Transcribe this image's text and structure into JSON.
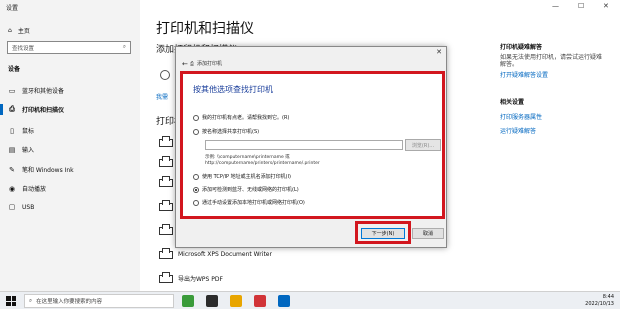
{
  "window": {
    "title": "设置",
    "controls": [
      "—",
      "☐",
      "✕"
    ]
  },
  "sidebar": {
    "home": "主页",
    "search_placeholder": "查找设置",
    "section": "设备",
    "items": [
      {
        "label": "蓝牙和其他设备",
        "icon": "bluetooth-icon"
      },
      {
        "label": "打印机和扫描仪",
        "icon": "printer-icon"
      },
      {
        "label": "鼠标",
        "icon": "mouse-icon"
      },
      {
        "label": "输入",
        "icon": "keyboard-icon"
      },
      {
        "label": "笔和 Windows Ink",
        "icon": "pen-icon"
      },
      {
        "label": "自动播放",
        "icon": "autoplay-icon"
      },
      {
        "label": "USB",
        "icon": "usb-icon"
      }
    ]
  },
  "main": {
    "title": "打印机和扫描仪",
    "add_heading": "添加打印机和扫描仪",
    "link_partial": "我需",
    "printers_heading": "打印机和扫描仪",
    "printers": [
      "Microsoft XPS Document Writer",
      "导出为WPS PDF"
    ]
  },
  "right": {
    "trouble_title": "打印机疑难解答",
    "trouble_text": [
      "如果无法使用打印机，请尝试运行疑难",
      "解答。"
    ],
    "trouble_link": "打开疑难解答设置",
    "related_title": "相关设置",
    "related_links": [
      "打印服务器属性",
      "运行疑难解答"
    ]
  },
  "dialog": {
    "header": "添加打印机",
    "heading": "按其他选项查找打印机",
    "options": [
      {
        "label": "我的打印机有点老。请帮我找到它。(R)",
        "checked": false
      },
      {
        "label": "按名称选择共享打印机(S)",
        "checked": false
      },
      {
        "label": "使用 TCP/IP 地址或主机名添加打印机(I)",
        "checked": false
      },
      {
        "label": "添加可检测到蓝牙、无线或网络的打印机(L)",
        "checked": true
      },
      {
        "label": "通过手动设置添加本地打印机或网络打印机(O)",
        "checked": false
      }
    ],
    "browse_label": "浏览(R)...",
    "example_lines": [
      "示例: \\\\computername\\printername 或",
      "http://computername/printers/printername/.printer"
    ],
    "next_label": "下一步(N)",
    "cancel_label": "取消"
  },
  "taskbar": {
    "search_placeholder": "在这里输入你要搜索的内容",
    "time": "8:44",
    "date": "2022/10/13"
  },
  "colors": {
    "highlight_red": "#d2161e",
    "accent_blue": "#0067c0"
  }
}
